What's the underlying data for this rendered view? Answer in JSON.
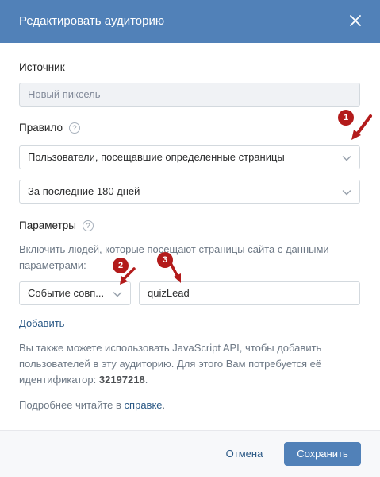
{
  "header": {
    "title": "Редактировать аудиторию"
  },
  "source": {
    "label": "Источник",
    "value": "Новый пиксель"
  },
  "rule": {
    "label": "Правило",
    "help": "?",
    "select_value": "Пользователи, посещавшие определенные страницы",
    "period_value": "За последние 180 дней"
  },
  "params": {
    "label": "Параметры",
    "help": "?",
    "description": "Включить людей, которые посещают страницы сайта с данными параметрами:",
    "condition_value": "Событие совп...",
    "input_value": "quizLead",
    "add_link": "Добавить"
  },
  "info": {
    "text_before": "Вы также можете использовать JavaScript API, чтобы добавить пользователей в эту аудиторию. Для этого Вам потребуется её идентификатор:",
    "identifier": "32197218",
    "text_after": ".",
    "more_before": "Подробнее читайте в",
    "more_link": "справке",
    "more_after": "."
  },
  "footer": {
    "cancel_label": "Отмена",
    "save_label": "Сохранить"
  },
  "annotations": {
    "badge_1": "1",
    "badge_2": "2",
    "badge_3": "3"
  },
  "colors": {
    "header": "#5181b8",
    "link": "#2a5885",
    "badge": "#b31b1b"
  }
}
